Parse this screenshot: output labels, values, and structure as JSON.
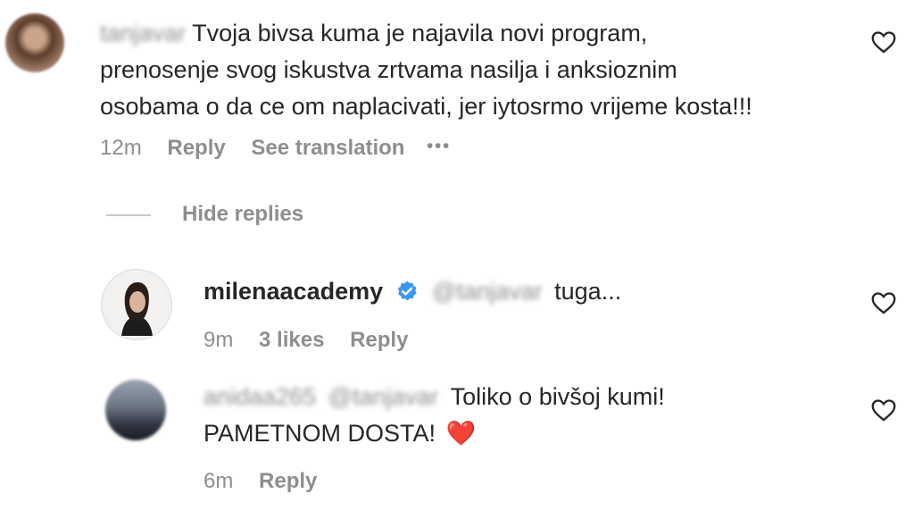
{
  "comments": [
    {
      "username": "tanjavar",
      "text_line1": "Tvoja bivsa kuma je najavila novi program,",
      "text_line2": "prenosenje svog iskustva zrtvama nasilja i anksioznim",
      "text_line3": "osobama o da ce om naplacivati, jer iytosrmo vrijeme kosta!!!",
      "time": "12m",
      "reply_label": "Reply",
      "translate_label": "See translation",
      "more_label": "•••"
    }
  ],
  "hide_replies_label": "Hide replies",
  "replies": [
    {
      "username": "milenaacademy",
      "mention": "@tanjavar",
      "text": "tuga...",
      "time": "9m",
      "likes": "3 likes",
      "reply_label": "Reply"
    },
    {
      "username": "anidaa265",
      "mention": "@tanjavar",
      "text_line1": "Toliko o bivšoj kumi!",
      "text_line2": "PAMETNOM DOSTA!",
      "emoji": "❤️",
      "time": "6m",
      "reply_label": "Reply"
    }
  ],
  "colors": {
    "text": "#262626",
    "secondary": "#8e8e8e",
    "verified": "#3897f0",
    "heart_emoji": "#e0282e"
  },
  "icons": [
    "heart-outline-icon",
    "verified-badge-icon",
    "more-icon"
  ]
}
